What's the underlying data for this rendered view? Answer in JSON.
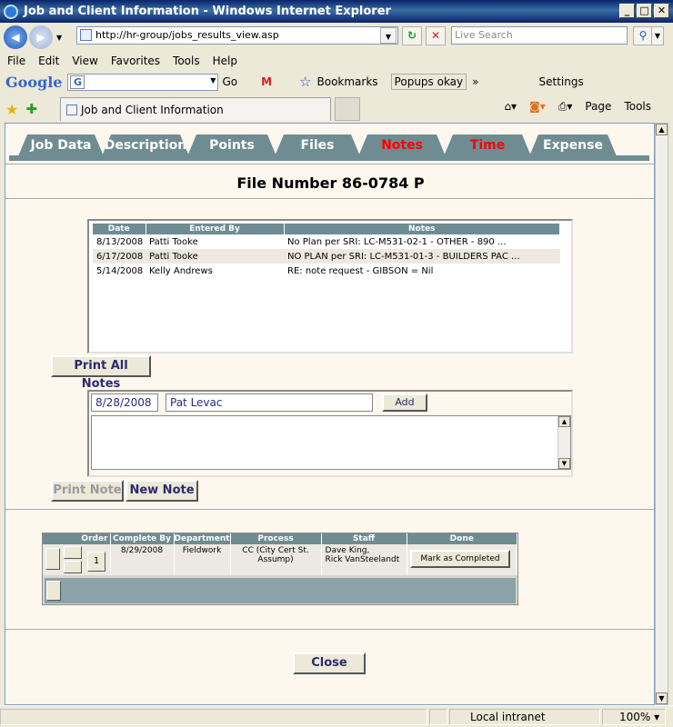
{
  "window": {
    "title": "Job and Client Information - Windows Internet Explorer"
  },
  "address": {
    "url": "http://hr-group/jobs_results_view.asp",
    "search_placeholder": "Live Search"
  },
  "menu": [
    "File",
    "Edit",
    "View",
    "Favorites",
    "Tools",
    "Help"
  ],
  "google_bar": {
    "logo": "Google",
    "go": "Go",
    "bookmarks": "Bookmarks",
    "popups": "Popups okay",
    "settings": "Settings"
  },
  "ie_tab": {
    "title": "Job and Client Information"
  },
  "commands": {
    "page": "Page",
    "tools": "Tools"
  },
  "tabs": [
    "Job Data",
    "Description",
    "Points",
    "Files",
    "Notes",
    "Time",
    "Expense"
  ],
  "active_tab": "Notes",
  "file_number": "File Number 86-0784 P",
  "notes": {
    "headers": [
      "Date",
      "Entered By",
      "Notes"
    ],
    "rows": [
      {
        "date": "8/13/2008",
        "by": "Patti Tooke",
        "note": "No Plan per SRI: LC-M531-02-1 - OTHER - 890 ..."
      },
      {
        "date": "6/17/2008",
        "by": "Patti Tooke",
        "note": "NO PLAN per SRI: LC-M531-01-3 - BUILDERS PAC ..."
      },
      {
        "date": "5/14/2008",
        "by": "Kelly Andrews",
        "note": "RE: note request - GIBSON = Nil"
      }
    ]
  },
  "buttons": {
    "print_all": "Print All Notes",
    "add": "Add",
    "print_note": "Print Note",
    "new_note": "New Note",
    "mark_completed": "Mark as Completed",
    "close": "Close",
    "order_num": "1"
  },
  "entry": {
    "date": "8/28/2008",
    "name": "Pat Levac"
  },
  "process": {
    "headers": [
      "Order",
      "Complete By",
      "Department",
      "Process",
      "Staff",
      "Done"
    ],
    "row": {
      "complete_by": "8/29/2008",
      "department": "Fieldwork",
      "process_l1": "CC (City Cert St.",
      "process_l2": "Assump)",
      "staff_l1": "Dave King,",
      "staff_l2": "Rick VanSteelandt"
    }
  },
  "status": {
    "zone": "Local intranet",
    "zoom": "100%"
  },
  "colors": {
    "tab_bg": "#6f8c92",
    "active_tab_text": "#ff0000",
    "content_bg": "#fdf7ee"
  }
}
